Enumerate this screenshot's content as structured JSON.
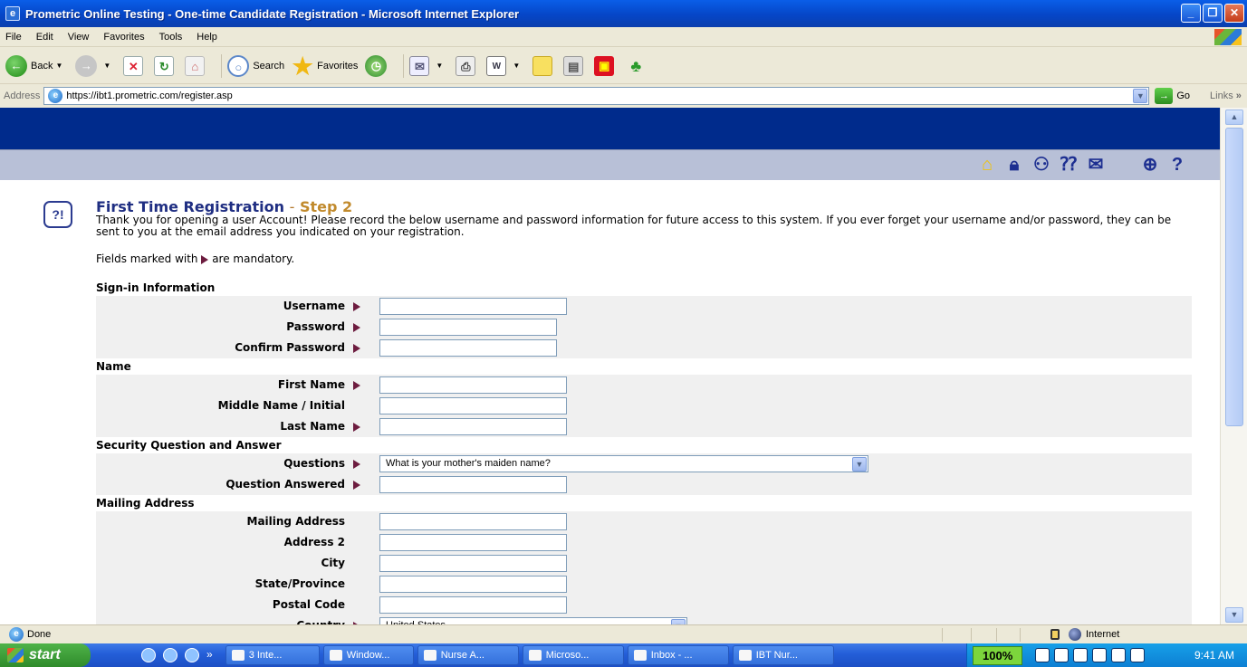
{
  "window": {
    "title": "Prometric Online Testing - One-time Candidate Registration - Microsoft Internet Explorer"
  },
  "menu": [
    "File",
    "Edit",
    "View",
    "Favorites",
    "Tools",
    "Help"
  ],
  "toolbar": {
    "back_label": "Back",
    "search_label": "Search",
    "favorites_label": "Favorites"
  },
  "address": {
    "label": "Address",
    "url": "https://ibt1.prometric.com/register.asp",
    "go_label": "Go",
    "links_label": "Links"
  },
  "page": {
    "title_main": "First Time Registration",
    "title_dash": "-",
    "title_step": "Step 2",
    "intro": "Thank you for opening a user Account! Please record the below username and password information for future access to this system. If you ever forget your username and/or password, they can be sent to you at the email address you indicated on your registration.",
    "mandatory_prefix": "Fields marked with",
    "mandatory_suffix": "are mandatory."
  },
  "form": {
    "sections": [
      {
        "title": "Sign-in Information",
        "fields": [
          {
            "label": "Username",
            "required": true,
            "type": "text",
            "value": ""
          },
          {
            "label": "Password",
            "required": true,
            "type": "password",
            "value": ""
          },
          {
            "label": "Confirm Password",
            "required": true,
            "type": "password",
            "value": ""
          }
        ]
      },
      {
        "title": "Name",
        "fields": [
          {
            "label": "First Name",
            "required": true,
            "type": "text",
            "value": ""
          },
          {
            "label": "Middle Name / Initial",
            "required": false,
            "type": "text",
            "value": ""
          },
          {
            "label": "Last Name",
            "required": true,
            "type": "text",
            "value": ""
          }
        ]
      },
      {
        "title": "Security Question and Answer",
        "fields": [
          {
            "label": "Questions",
            "required": true,
            "type": "select",
            "value": "What is your mother's maiden name?"
          },
          {
            "label": "Question Answered",
            "required": true,
            "type": "text",
            "value": ""
          }
        ]
      },
      {
        "title": "Mailing Address",
        "fields": [
          {
            "label": "Mailing Address",
            "required": false,
            "type": "text",
            "value": ""
          },
          {
            "label": "Address 2",
            "required": false,
            "type": "text",
            "value": ""
          },
          {
            "label": "City",
            "required": false,
            "type": "text",
            "value": ""
          },
          {
            "label": "State/Province",
            "required": false,
            "type": "text",
            "value": ""
          },
          {
            "label": "Postal Code",
            "required": false,
            "type": "text",
            "value": ""
          },
          {
            "label": "Country",
            "required": true,
            "type": "select",
            "value": "United States"
          }
        ]
      }
    ]
  },
  "status": {
    "text": "Done",
    "zone": "Internet"
  },
  "taskbar": {
    "start_label": "start",
    "tasks": [
      "3 Inte...",
      "Window...",
      "Nurse A...",
      "Microso...",
      "Inbox - ...",
      "IBT Nur..."
    ],
    "zoom": "100%",
    "clock": "9:41 AM"
  },
  "colors": {
    "banner": "#002b8c",
    "nav_strip": "#b8c0d7",
    "title_blue": "#1f2e82",
    "step_gold": "#c18a2c",
    "required_marker": "#6d1c3f"
  }
}
